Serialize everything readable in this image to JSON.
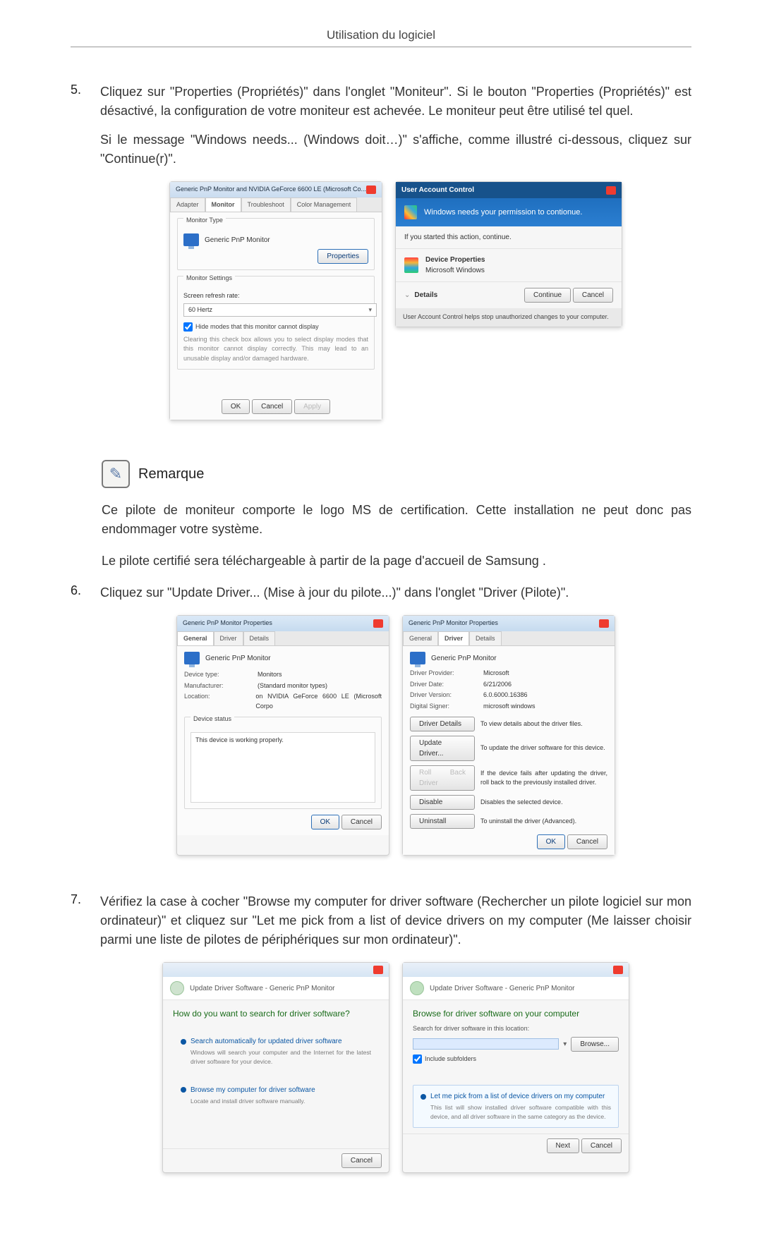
{
  "header": {
    "title": "Utilisation du logiciel"
  },
  "steps": {
    "s5": {
      "num": "5.",
      "p1": "Cliquez sur \"Properties (Propriétés)\" dans l'onglet \"Moniteur\". Si le bouton \"Properties (Propriétés)\" est désactivé, la configuration de votre moniteur est achevée. Le moniteur peut être utilisé tel quel.",
      "p2": "Si le message \"Windows needs... (Windows doit…)\" s'affiche, comme illustré ci-dessous, cliquez sur \"Continue(r)\"."
    },
    "s6": {
      "num": "6.",
      "p1": "Cliquez sur \"Update Driver... (Mise à jour du pilote...)\" dans l'onglet \"Driver (Pilote)\"."
    },
    "s7": {
      "num": "7.",
      "p1": "Vérifiez la case à cocher \"Browse my computer for driver software (Rechercher un pilote logiciel sur mon ordinateur)\" et cliquez sur \"Let me pick from a list of device drivers on my computer (Me laisser choisir parmi une liste de pilotes de périphériques sur mon ordinateur)\"."
    }
  },
  "remark": {
    "label": "Remarque",
    "p1": "Ce pilote de moniteur comporte le logo MS de certification. Cette installation ne peut donc pas endommager votre système.",
    "p2": "Le pilote certifié sera téléchargeable à partir de la page d'accueil de Samsung ."
  },
  "dlg_monitor": {
    "title": "Generic PnP Monitor and NVIDIA GeForce 6600 LE (Microsoft Co...",
    "tabs": {
      "adapter": "Adapter",
      "monitor": "Monitor",
      "troubleshoot": "Troubleshoot",
      "color": "Color Management"
    },
    "type_section": "Monitor Type",
    "type_value": "Generic PnP Monitor",
    "btn_properties": "Properties",
    "settings_section": "Monitor Settings",
    "refresh_label": "Screen refresh rate:",
    "refresh_value": "60 Hertz",
    "hide_label": "Hide modes that this monitor cannot display",
    "hide_note": "Clearing this check box allows you to select display modes that this monitor cannot display correctly. This may lead to an unusable display and/or damaged hardware.",
    "ok": "OK",
    "cancel": "Cancel",
    "apply": "Apply"
  },
  "dlg_uac": {
    "title": "User Account Control",
    "headline": "Windows needs your permission to contionue.",
    "started": "If you started this action, continue.",
    "prog_name": "Device Properties",
    "prog_pub": "Microsoft Windows",
    "details": "Details",
    "continue": "Continue",
    "cancel": "Cancel",
    "footer": "User Account Control helps stop unauthorized changes to your computer."
  },
  "dlg_props_general": {
    "title": "Generic PnP Monitor Properties",
    "tabs": {
      "general": "General",
      "driver": "Driver",
      "details": "Details"
    },
    "name": "Generic PnP Monitor",
    "k_type": "Device type:",
    "v_type": "Monitors",
    "k_manu": "Manufacturer:",
    "v_manu": "(Standard monitor types)",
    "k_loc": "Location:",
    "v_loc": "on NVIDIA GeForce 6600 LE (Microsoft Corpo",
    "status_section": "Device status",
    "status_text": "This device is working properly.",
    "ok": "OK",
    "cancel": "Cancel"
  },
  "dlg_props_driver": {
    "title": "Generic PnP Monitor Properties",
    "tabs": {
      "general": "General",
      "driver": "Driver",
      "details": "Details"
    },
    "name": "Generic PnP Monitor",
    "k_prov": "Driver Provider:",
    "v_prov": "Microsoft",
    "k_date": "Driver Date:",
    "v_date": "6/21/2006",
    "k_ver": "Driver Version:",
    "v_ver": "6.0.6000.16386",
    "k_sign": "Digital Signer:",
    "v_sign": "microsoft windows",
    "btn_details": "Driver Details",
    "d_details": "To view details about the driver files.",
    "btn_update": "Update Driver...",
    "d_update": "To update the driver software for this device.",
    "btn_rollback": "Roll Back Driver",
    "d_rollback": "If the device fails after updating the driver, roll back to the previously installed driver.",
    "btn_disable": "Disable",
    "d_disable": "Disables the selected device.",
    "btn_uninstall": "Uninstall",
    "d_uninstall": "To uninstall the driver (Advanced).",
    "ok": "OK",
    "cancel": "Cancel"
  },
  "dlg_wiz_search": {
    "crumb": "Update Driver Software - Generic PnP Monitor",
    "question": "How do you want to search for driver software?",
    "opt1_t": "Search automatically for updated driver software",
    "opt1_d": "Windows will search your computer and the Internet for the latest driver software for your device.",
    "opt2_t": "Browse my computer for driver software",
    "opt2_d": "Locate and install driver software manually.",
    "cancel": "Cancel"
  },
  "dlg_wiz_browse": {
    "crumb": "Update Driver Software - Generic PnP Monitor",
    "heading": "Browse for driver software on your computer",
    "loc_label": "Search for driver software in this location:",
    "browse": "Browse...",
    "include": "Include subfolders",
    "pick_t": "Let me pick from a list of device drivers on my computer",
    "pick_d": "This list will show installed driver software compatible with this device, and all driver software in the same category as the device.",
    "next": "Next",
    "cancel": "Cancel"
  }
}
